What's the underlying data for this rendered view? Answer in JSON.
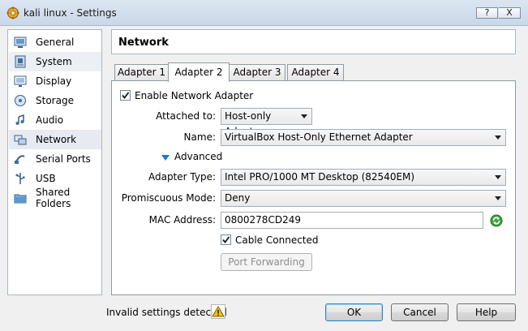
{
  "window": {
    "title": "kali linux - Settings",
    "help_btn": "?",
    "close_btn": "X"
  },
  "sidebar": {
    "items": [
      {
        "label": "General",
        "icon": "general-icon"
      },
      {
        "label": "System",
        "icon": "system-icon"
      },
      {
        "label": "Display",
        "icon": "display-icon"
      },
      {
        "label": "Storage",
        "icon": "storage-icon"
      },
      {
        "label": "Audio",
        "icon": "audio-icon"
      },
      {
        "label": "Network",
        "icon": "network-icon"
      },
      {
        "label": "Serial Ports",
        "icon": "serial-ports-icon"
      },
      {
        "label": "USB",
        "icon": "usb-icon"
      },
      {
        "label": "Shared Folders",
        "icon": "shared-folders-icon"
      }
    ],
    "selected": "Network"
  },
  "page": {
    "title": "Network"
  },
  "tabs": [
    {
      "label": "Adapter 1"
    },
    {
      "label": "Adapter 2"
    },
    {
      "label": "Adapter 3"
    },
    {
      "label": "Adapter 4"
    }
  ],
  "active_tab": "Adapter 2",
  "adapter": {
    "enable_label": "Enable Network Adapter",
    "enable_checked": true,
    "attached_label": "Attached to:",
    "attached_value": "Host-only Adapter",
    "name_label": "Name:",
    "name_value": "VirtualBox Host-Only Ethernet Adapter",
    "advanced_label": "Advanced",
    "adapter_type_label": "Adapter Type:",
    "adapter_type_value": "Intel PRO/1000 MT Desktop (82540EM)",
    "promiscuous_label": "Promiscuous Mode:",
    "promiscuous_value": "Deny",
    "mac_label": "MAC Address:",
    "mac_value": "0800278CD249",
    "cable_label": "Cable Connected",
    "cable_checked": true,
    "port_forwarding_label": "Port Forwarding"
  },
  "footer": {
    "status_text": "Invalid settings detected",
    "ok": "OK",
    "cancel": "Cancel",
    "help": "Help"
  },
  "colors": {
    "accent_blue": "#1e7ac7",
    "warning_yellow": "#f5c800",
    "refresh_green": "#2f9a2f"
  }
}
